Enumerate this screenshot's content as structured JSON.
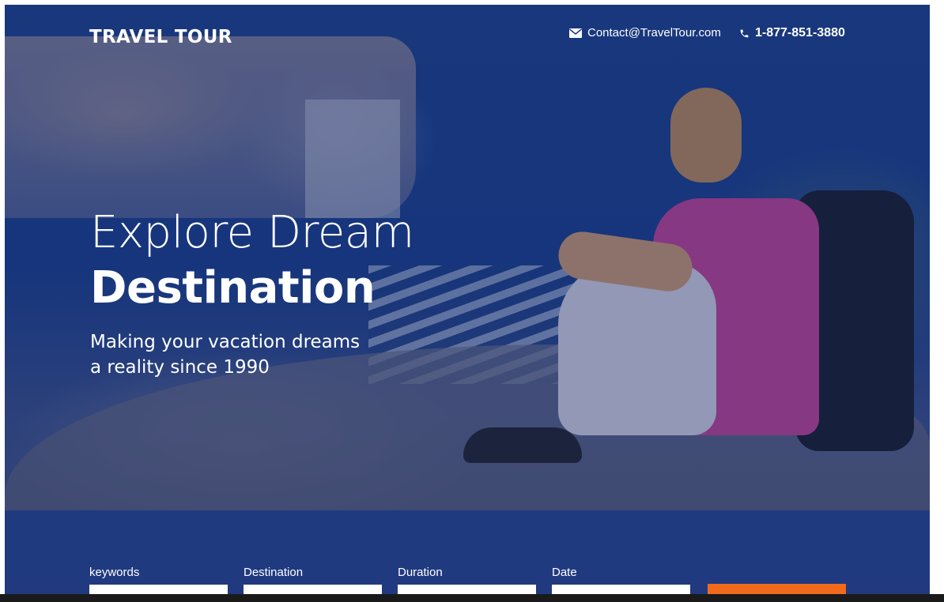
{
  "brand": {
    "logo_text": "TRAVEL TOUR"
  },
  "header": {
    "email_icon": "envelope-icon",
    "email": "Contact@TravelTour.com",
    "phone_icon": "phone-icon",
    "phone": "1-877-851-3880"
  },
  "hero": {
    "title_line1": "Explore Dream",
    "title_line2": "Destination",
    "tagline_line1": "Making your vacation dreams",
    "tagline_line2": "a reality since 1990"
  },
  "search": {
    "fields": [
      {
        "label": "keywords",
        "value": ""
      },
      {
        "label": "Destination",
        "value": ""
      },
      {
        "label": "Duration",
        "value": ""
      },
      {
        "label": "Date",
        "value": ""
      }
    ],
    "button_label": ""
  },
  "colors": {
    "overlay_blue": "#1c3d84",
    "accent_orange": "#f26a1b"
  }
}
